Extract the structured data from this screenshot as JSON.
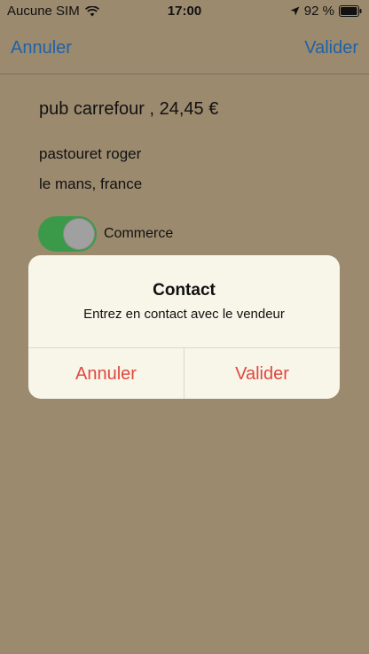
{
  "status_bar": {
    "carrier": "Aucune SIM",
    "time": "17:00",
    "battery": "92 %"
  },
  "nav": {
    "cancel_label": "Annuler",
    "confirm_label": "Valider"
  },
  "content": {
    "title": "pub carrefour , 24,45 €",
    "name": "pastouret roger",
    "location": "le mans, france",
    "toggle_label": "Commerce",
    "toggle_on": true
  },
  "alert": {
    "title": "Contact",
    "message": "Entrez en contact avec le vendeur",
    "cancel_label": "Annuler",
    "confirm_label": "Valider"
  },
  "colors": {
    "background": "#9b8a6e",
    "nav_link": "#1f62a8",
    "alert_button": "#e0483f",
    "toggle_on": "#3b9a4a",
    "alert_bg": "#f8f5e9"
  },
  "icons": [
    "wifi-icon",
    "location-arrow-icon",
    "battery-icon"
  ]
}
